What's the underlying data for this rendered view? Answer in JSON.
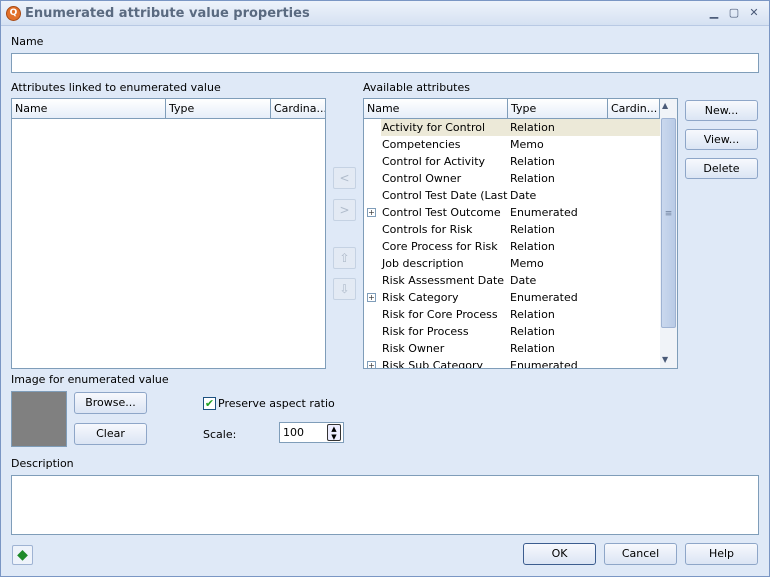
{
  "window": {
    "title": "Enumerated attribute value properties",
    "minimize": "▁",
    "maximize": "▢",
    "close": "✕"
  },
  "name": {
    "label": "Name",
    "value": ""
  },
  "linked": {
    "label": "Attributes linked to enumerated value",
    "columns": [
      "Name",
      "Type",
      "Cardina..."
    ],
    "rows": []
  },
  "available": {
    "label": "Available attributes",
    "columns": [
      "Name",
      "Type",
      "Cardin..."
    ],
    "rows": [
      {
        "name": "Activity for Control",
        "type": "Relation",
        "expandable": false,
        "selected": true
      },
      {
        "name": "Competencies",
        "type": "Memo",
        "expandable": false
      },
      {
        "name": "Control for Activity",
        "type": "Relation",
        "expandable": false
      },
      {
        "name": "Control Owner",
        "type": "Relation",
        "expandable": false
      },
      {
        "name": "Control Test Date (Last)",
        "type": "Date",
        "expandable": false
      },
      {
        "name": "Control Test Outcome",
        "type": "Enumerated",
        "expandable": true
      },
      {
        "name": "Controls for Risk",
        "type": "Relation",
        "expandable": false
      },
      {
        "name": "Core Process for Risk",
        "type": "Relation",
        "expandable": false
      },
      {
        "name": "Job description",
        "type": "Memo",
        "expandable": false
      },
      {
        "name": "Risk Assessment Date (Last)",
        "type": "Date",
        "expandable": false
      },
      {
        "name": "Risk Category",
        "type": "Enumerated",
        "expandable": true
      },
      {
        "name": "Risk for Core Process",
        "type": "Relation",
        "expandable": false
      },
      {
        "name": "Risk for Process",
        "type": "Relation",
        "expandable": false
      },
      {
        "name": "Risk Owner",
        "type": "Relation",
        "expandable": false
      },
      {
        "name": "Risk Sub Category",
        "type": "Enumerated",
        "expandable": true
      }
    ]
  },
  "move": {
    "left": "<",
    "right": ">",
    "up": "⇧",
    "down": "⇩"
  },
  "side_buttons": {
    "new": "New...",
    "view": "View...",
    "delete": "Delete"
  },
  "image": {
    "label": "Image for enumerated value",
    "browse": "Browse...",
    "clear": "Clear",
    "preserve_label": "Preserve aspect ratio",
    "preserve_checked": true,
    "scale_label": "Scale:",
    "scale_value": "100"
  },
  "description": {
    "label": "Description",
    "value": ""
  },
  "footer": {
    "ok": "OK",
    "cancel": "Cancel",
    "help": "Help"
  }
}
